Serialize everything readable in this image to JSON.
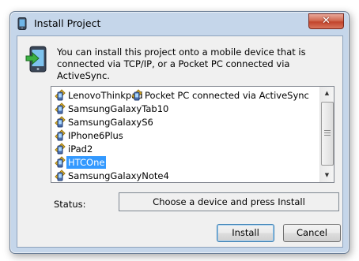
{
  "window": {
    "title": "Install Project",
    "close_glyph": "✕",
    "title_icon": "mobile-device-icon"
  },
  "intro": {
    "icon": "install-to-device-icon",
    "text": "You can install this project onto a mobile device that is connected via TCP/IP, or a Pocket PC connected via ActiveSync."
  },
  "device_list": {
    "item_icon": "mobile-device-icon",
    "items": [
      {
        "label": "LenovoThinkpad",
        "selected": false
      },
      {
        "label": "Pocket PC connected via ActiveSync",
        "selected": false
      },
      {
        "label": "SamsungGalaxyTab10",
        "selected": false
      },
      {
        "label": "SamsungGalaxyS6",
        "selected": false
      },
      {
        "label": "IPhone6Plus",
        "selected": false
      },
      {
        "label": "iPad2",
        "selected": false
      },
      {
        "label": "HTCOne",
        "selected": true
      },
      {
        "label": "SamsungGalaxyNote4",
        "selected": false
      }
    ],
    "scroll_up_glyph": "▲",
    "scroll_down_glyph": "▼"
  },
  "status": {
    "label": "Status:",
    "value": "Choose a device and press Install"
  },
  "buttons": {
    "install": "Install",
    "cancel": "Cancel"
  },
  "colors": {
    "selection": "#3399ff",
    "window_frame": "#c5d6ea",
    "close_button": "#c2452c"
  }
}
